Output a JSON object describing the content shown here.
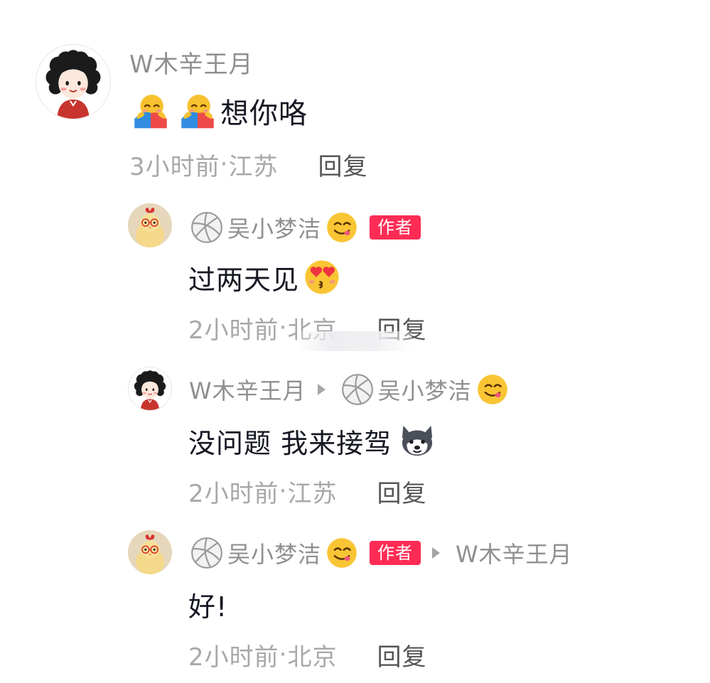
{
  "comments": [
    {
      "author": "W木辛王月",
      "content": "想你咯",
      "content_emojis_before": [
        "hugging-face-icon",
        "hugging-face-icon"
      ],
      "time": "3小时前",
      "location": "江苏",
      "reply_label": "回复"
    }
  ],
  "replies": [
    {
      "prefix_icon": "volleyball-icon",
      "author": "吴小梦洁",
      "author_emoji": "yum-face-icon",
      "badge": "作者",
      "content": "过两天见",
      "content_emoji_after": "kissing-heart-eyes-icon",
      "time": "2小时前",
      "location": "北京",
      "reply_label": "回复"
    },
    {
      "author": "W木辛王月",
      "reply_to_prefix_icon": "volleyball-icon",
      "reply_to": "吴小梦洁",
      "reply_to_emoji": "yum-face-icon",
      "content": "没问题 我来接驾",
      "content_emoji_after": "husky-dog-icon",
      "time": "2小时前",
      "location": "江苏",
      "reply_label": "回复"
    },
    {
      "prefix_icon": "volleyball-icon",
      "author": "吴小梦洁",
      "author_emoji": "yum-face-icon",
      "badge": "作者",
      "reply_to": "W木辛王月",
      "content": "好!",
      "time": "2小时前",
      "location": "北京",
      "reply_label": "回复"
    }
  ],
  "separator": " · ",
  "colors": {
    "name": "#8f8f8f",
    "content": "#161823",
    "meta": "#a8a8a8",
    "reply": "#555555",
    "badge": "#fe2c55"
  }
}
